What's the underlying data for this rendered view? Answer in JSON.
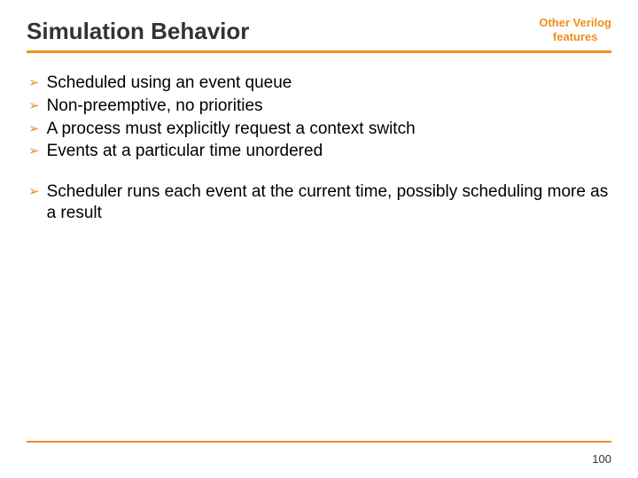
{
  "header": {
    "title": "Simulation Behavior",
    "category_line1": "Other Verilog",
    "category_line2": "features"
  },
  "bullets": {
    "group1": [
      "Scheduled using an event queue",
      "Non-preemptive, no priorities",
      "A process must explicitly request a context switch",
      "Events at a particular time unordered"
    ],
    "group2": [
      "Scheduler runs each event at the current time, possibly scheduling more as a result"
    ]
  },
  "footer": {
    "page_number": "100"
  },
  "marker": "➢"
}
